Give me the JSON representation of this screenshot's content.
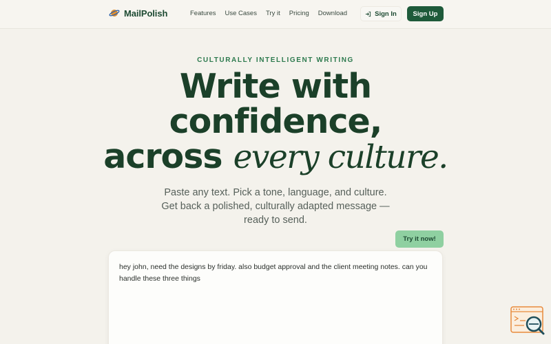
{
  "nav": {
    "brand": "MailPolish",
    "links": [
      "Features",
      "Use Cases",
      "Try it",
      "Pricing",
      "Download"
    ],
    "sign_in": "Sign In",
    "sign_up": "Sign Up"
  },
  "hero": {
    "eyebrow": "CULTURALLY INTELLIGENT WRITING",
    "line1": "Write with",
    "line2": "confidence,",
    "line3_plain": "across",
    "line3_italic": "every culture.",
    "subtitle": "Paste any text. Pick a tone, language, and culture. Get back a polished, culturally adapted message — ready to send.",
    "try_button": "Try it now!"
  },
  "editor": {
    "value": "hey john, need the designs by friday. also budget approval and the client meeting notes. can you handle these three things"
  },
  "colors": {
    "accent": "#1e5a3a",
    "brand_text": "#1d4a32",
    "eyebrow": "#2d7a4e",
    "try_button": "#8fd0a1",
    "background": "#f4f2ec"
  },
  "icons": {
    "brand": "planet-icon",
    "sign_in": "login-icon",
    "fab": "search-analytics-icon"
  }
}
